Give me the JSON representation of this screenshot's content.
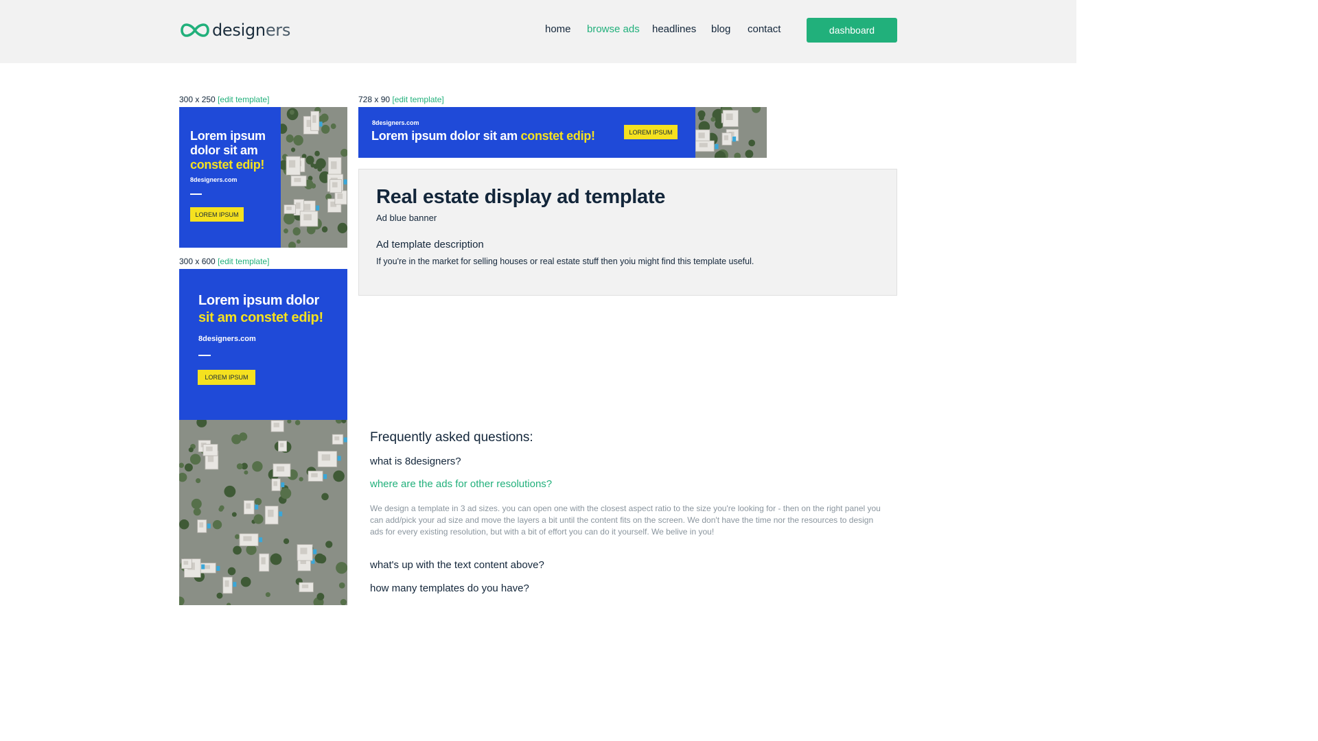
{
  "brand": {
    "logo_text_strong": "design",
    "logo_text_soft": "ers",
    "accent": "#21b07b"
  },
  "nav": {
    "items": [
      {
        "label": "home"
      },
      {
        "label": "browse ads",
        "active": true
      },
      {
        "label": "headlines"
      },
      {
        "label": "blog"
      },
      {
        "label": "contact"
      }
    ],
    "dashboard_label": "dashboard"
  },
  "templates": {
    "edit_label": "[edit template]",
    "square": {
      "size": "300 x 250",
      "headline_1": "Lorem ipsum",
      "headline_2": "dolor sit am",
      "headline_hl": "constet edip!",
      "site": "8designers.com",
      "cta": "LOREM IPSUM"
    },
    "leaderboard": {
      "size": "728 x 90",
      "site": "8designers.com",
      "headline": "Lorem ipsum dolor sit am",
      "headline_hl": "constet edip!",
      "cta": "LOREM IPSUM"
    },
    "skyscraper": {
      "size": "300 x 600",
      "headline_1": "Lorem ipsum dolor",
      "headline_hl": "sit am constet edip!",
      "site": "8designers.com",
      "cta": "LOREM IPSUM"
    },
    "banner_blue": "#1f4ad8",
    "highlight_yellow": "#f5e11f"
  },
  "details": {
    "title": "Real estate display ad template",
    "subtitle": "Ad blue banner",
    "desc_heading": "Ad template description",
    "description": "If you're in the market for selling houses or real estate stuff then yoiu might find this template useful."
  },
  "faq": {
    "heading": "Frequently asked questions:",
    "questions": [
      {
        "q": "what is 8designers?"
      },
      {
        "q": "where are the ads for other resolutions?",
        "open": true
      },
      {
        "q": "what's up with the text content above?"
      },
      {
        "q": "how many templates do you have?"
      }
    ],
    "answer": "We design a template in 3 ad sizes. you can open one with the closest aspect ratio to the size you're looking for - then on the right panel you can add/pick your ad size and move the layers a bit until the content fits on the screen. We don't have the time nor the resources to design ads for every existing resolution, but with a bit of effort you can do it yourself. We belive in you!"
  }
}
